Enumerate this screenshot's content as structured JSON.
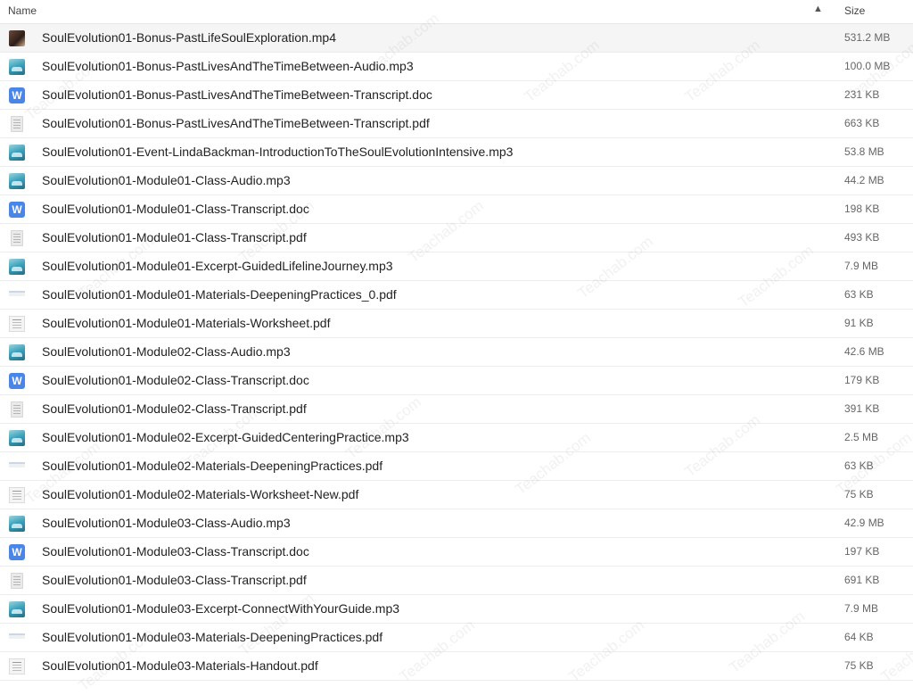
{
  "header": {
    "name_label": "Name",
    "sort_icon": "chevron-up-icon",
    "size_label": "Size"
  },
  "files": [
    {
      "name": "SoulEvolution01-Bonus-PastLifeSoulExploration.mp4",
      "size": "531.2 MB",
      "icon": "video"
    },
    {
      "name": "SoulEvolution01-Bonus-PastLivesAndTheTimeBetween-Audio.mp3",
      "size": "100.0 MB",
      "icon": "audio"
    },
    {
      "name": "SoulEvolution01-Bonus-PastLivesAndTheTimeBetween-Transcript.doc",
      "size": "231 KB",
      "icon": "doc"
    },
    {
      "name": "SoulEvolution01-Bonus-PastLivesAndTheTimeBetween-Transcript.pdf",
      "size": "663 KB",
      "icon": "pdf"
    },
    {
      "name": "SoulEvolution01-Event-LindaBackman-IntroductionToTheSoulEvolutionIntensive.mp3",
      "size": "53.8 MB",
      "icon": "audio"
    },
    {
      "name": "SoulEvolution01-Module01-Class-Audio.mp3",
      "size": "44.2 MB",
      "icon": "audio"
    },
    {
      "name": "SoulEvolution01-Module01-Class-Transcript.doc",
      "size": "198 KB",
      "icon": "doc"
    },
    {
      "name": "SoulEvolution01-Module01-Class-Transcript.pdf",
      "size": "493 KB",
      "icon": "pdf"
    },
    {
      "name": "SoulEvolution01-Module01-Excerpt-GuidedLifelineJourney.mp3",
      "size": "7.9 MB",
      "icon": "audio"
    },
    {
      "name": "SoulEvolution01-Module01-Materials-DeepeningPractices_0.pdf",
      "size": "63 KB",
      "icon": "pdfstrip"
    },
    {
      "name": "SoulEvolution01-Module01-Materials-Worksheet.pdf",
      "size": "91 KB",
      "icon": "pdfsheet"
    },
    {
      "name": "SoulEvolution01-Module02-Class-Audio.mp3",
      "size": "42.6 MB",
      "icon": "audio"
    },
    {
      "name": "SoulEvolution01-Module02-Class-Transcript.doc",
      "size": "179 KB",
      "icon": "doc"
    },
    {
      "name": "SoulEvolution01-Module02-Class-Transcript.pdf",
      "size": "391 KB",
      "icon": "pdf"
    },
    {
      "name": "SoulEvolution01-Module02-Excerpt-GuidedCenteringPractice.mp3",
      "size": "2.5 MB",
      "icon": "audio"
    },
    {
      "name": "SoulEvolution01-Module02-Materials-DeepeningPractices.pdf",
      "size": "63 KB",
      "icon": "pdfstrip"
    },
    {
      "name": "SoulEvolution01-Module02-Materials-Worksheet-New.pdf",
      "size": "75 KB",
      "icon": "pdfsheet"
    },
    {
      "name": "SoulEvolution01-Module03-Class-Audio.mp3",
      "size": "42.9 MB",
      "icon": "audio"
    },
    {
      "name": "SoulEvolution01-Module03-Class-Transcript.doc",
      "size": "197 KB",
      "icon": "doc"
    },
    {
      "name": "SoulEvolution01-Module03-Class-Transcript.pdf",
      "size": "691 KB",
      "icon": "pdf"
    },
    {
      "name": "SoulEvolution01-Module03-Excerpt-ConnectWithYourGuide.mp3",
      "size": "7.9 MB",
      "icon": "audio"
    },
    {
      "name": "SoulEvolution01-Module03-Materials-DeepeningPractices.pdf",
      "size": "64 KB",
      "icon": "pdfstrip"
    },
    {
      "name": "SoulEvolution01-Module03-Materials-Handout.pdf",
      "size": "75 KB",
      "icon": "pdfsheet"
    }
  ],
  "watermark_text": "Teachab.com",
  "colors": {
    "doc_icon": "#4a86e8",
    "audio_icon": "#3fa3bb",
    "selected_row_bg": "#f5f5f5"
  }
}
